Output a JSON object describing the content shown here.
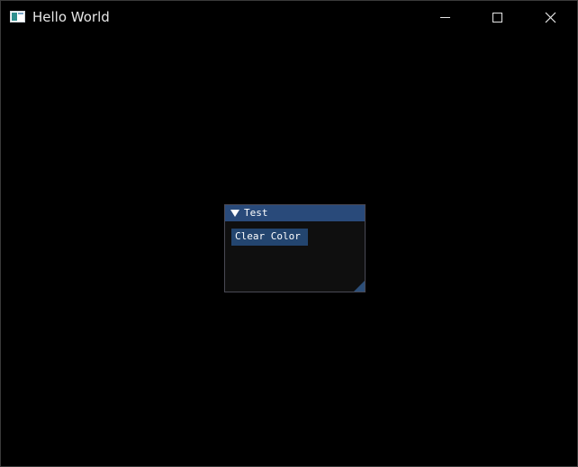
{
  "window": {
    "title": "Hello World",
    "icon": "app-window-icon"
  },
  "caption_buttons": {
    "minimize_icon": "minimize-icon",
    "maximize_icon": "maximize-icon",
    "close_icon": "close-icon"
  },
  "imgui_window": {
    "title": "Test",
    "collapse_icon": "collapse-arrow-icon",
    "button_label": "Clear Color",
    "resize_icon": "resize-grip-icon"
  },
  "colors": {
    "background": "#000000",
    "imgui_title_bg": "#294a7a",
    "imgui_button_bg": "#23456f",
    "imgui_window_bg": "#0f0f0f"
  }
}
